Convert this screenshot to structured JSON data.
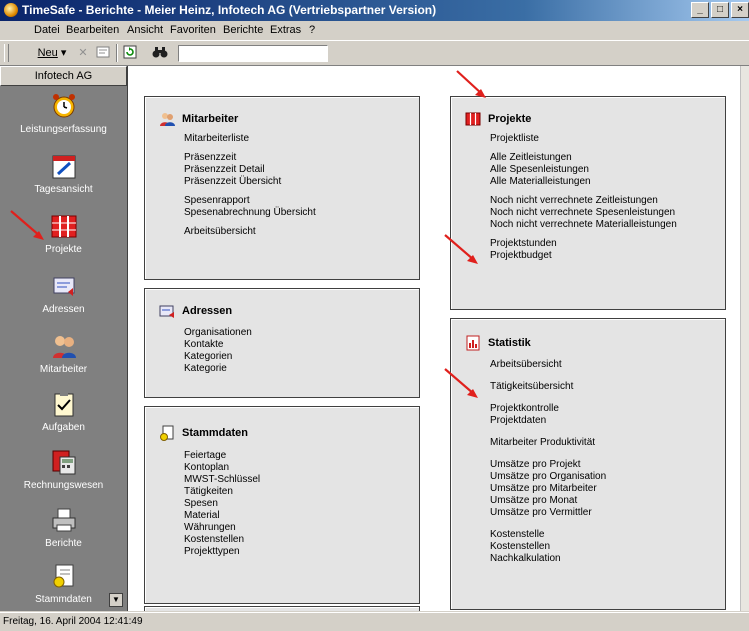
{
  "window": {
    "title": "TimeSafe - Berichte - Meier Heinz, Infotech AG  (Vertriebspartner Version)",
    "buttons": [
      "_",
      "□",
      "×"
    ]
  },
  "menubar": [
    "Datei",
    "Bearbeiten",
    "Ansicht",
    "Favoriten",
    "Berichte",
    "Extras",
    "?"
  ],
  "toolbar": {
    "new_label": "Neu",
    "search_value": ""
  },
  "sidebar": {
    "header": "Infotech AG",
    "items": [
      {
        "label": "Leistungserfassung",
        "icon": "alarm-clock-icon"
      },
      {
        "label": "Tagesansicht",
        "icon": "calendar-pen-icon"
      },
      {
        "label": "Projekte",
        "icon": "projects-icon"
      },
      {
        "label": "Adressen",
        "icon": "address-icon"
      },
      {
        "label": "Mitarbeiter",
        "icon": "people-icon"
      },
      {
        "label": "Aufgaben",
        "icon": "clipboard-check-icon"
      },
      {
        "label": "Rechnungswesen",
        "icon": "calculator-icon"
      },
      {
        "label": "Berichte",
        "icon": "printer-icon"
      },
      {
        "label": "Stammdaten",
        "icon": "master-data-icon"
      }
    ]
  },
  "panels": {
    "mitarbeiter": {
      "title": "Mitarbeiter",
      "groups": [
        [
          "Mitarbeiterliste"
        ],
        [
          "Präsenzzeit",
          "Präsenzzeit Detail",
          "Präsenzzeit Übersicht"
        ],
        [
          "Spesenrapport",
          "Spesenabrechnung Übersicht"
        ],
        [
          "Arbeitsübersicht"
        ]
      ]
    },
    "adressen": {
      "title": "Adressen",
      "groups": [
        [
          "Organisationen",
          "Kontakte",
          "Kategorien",
          "Kategorie"
        ]
      ]
    },
    "stammdaten": {
      "title": "Stammdaten",
      "groups": [
        [
          "Feiertage",
          "Kontoplan",
          "MWST-Schlüssel",
          "Tätigkeiten",
          "Spesen",
          "Material",
          "Währungen",
          "Kostenstellen",
          "Projekttypen"
        ]
      ]
    },
    "projekte": {
      "title": "Projekte",
      "groups": [
        [
          "Projektliste"
        ],
        [
          "Alle Zeitleistungen",
          "Alle Spesenleistungen",
          "Alle Materialleistungen"
        ],
        [
          "Noch nicht verrechnete Zeitleistungen",
          "Noch nicht verrechnete Spesenleistungen",
          "Noch nicht verrechnete Materialleistungen"
        ],
        [
          "Projektstunden",
          "Projektbudget"
        ]
      ]
    },
    "statistik": {
      "title": "Statistik",
      "groups": [
        [
          "Arbeitsübersicht"
        ],
        [
          "Tätigkeitsübersicht"
        ],
        [
          "Projektkontrolle",
          "Projektdaten"
        ],
        [
          "Mitarbeiter Produktivität"
        ],
        [
          "Umsätze pro Projekt",
          "Umsätze pro Organisation",
          "Umsätze pro Mitarbeiter",
          "Umsätze pro Monat",
          "Umsätze pro Vermittler"
        ],
        [
          "Kostenstelle",
          "Kostenstellen",
          "Nachkalkulation"
        ]
      ]
    }
  },
  "status": "Freitag, 16. April 2004 12:41:49",
  "colors": {
    "annotation_arrow": "#e0201c",
    "sidebar_bg": "#808080",
    "panel_bg": "#e4e4e4"
  }
}
